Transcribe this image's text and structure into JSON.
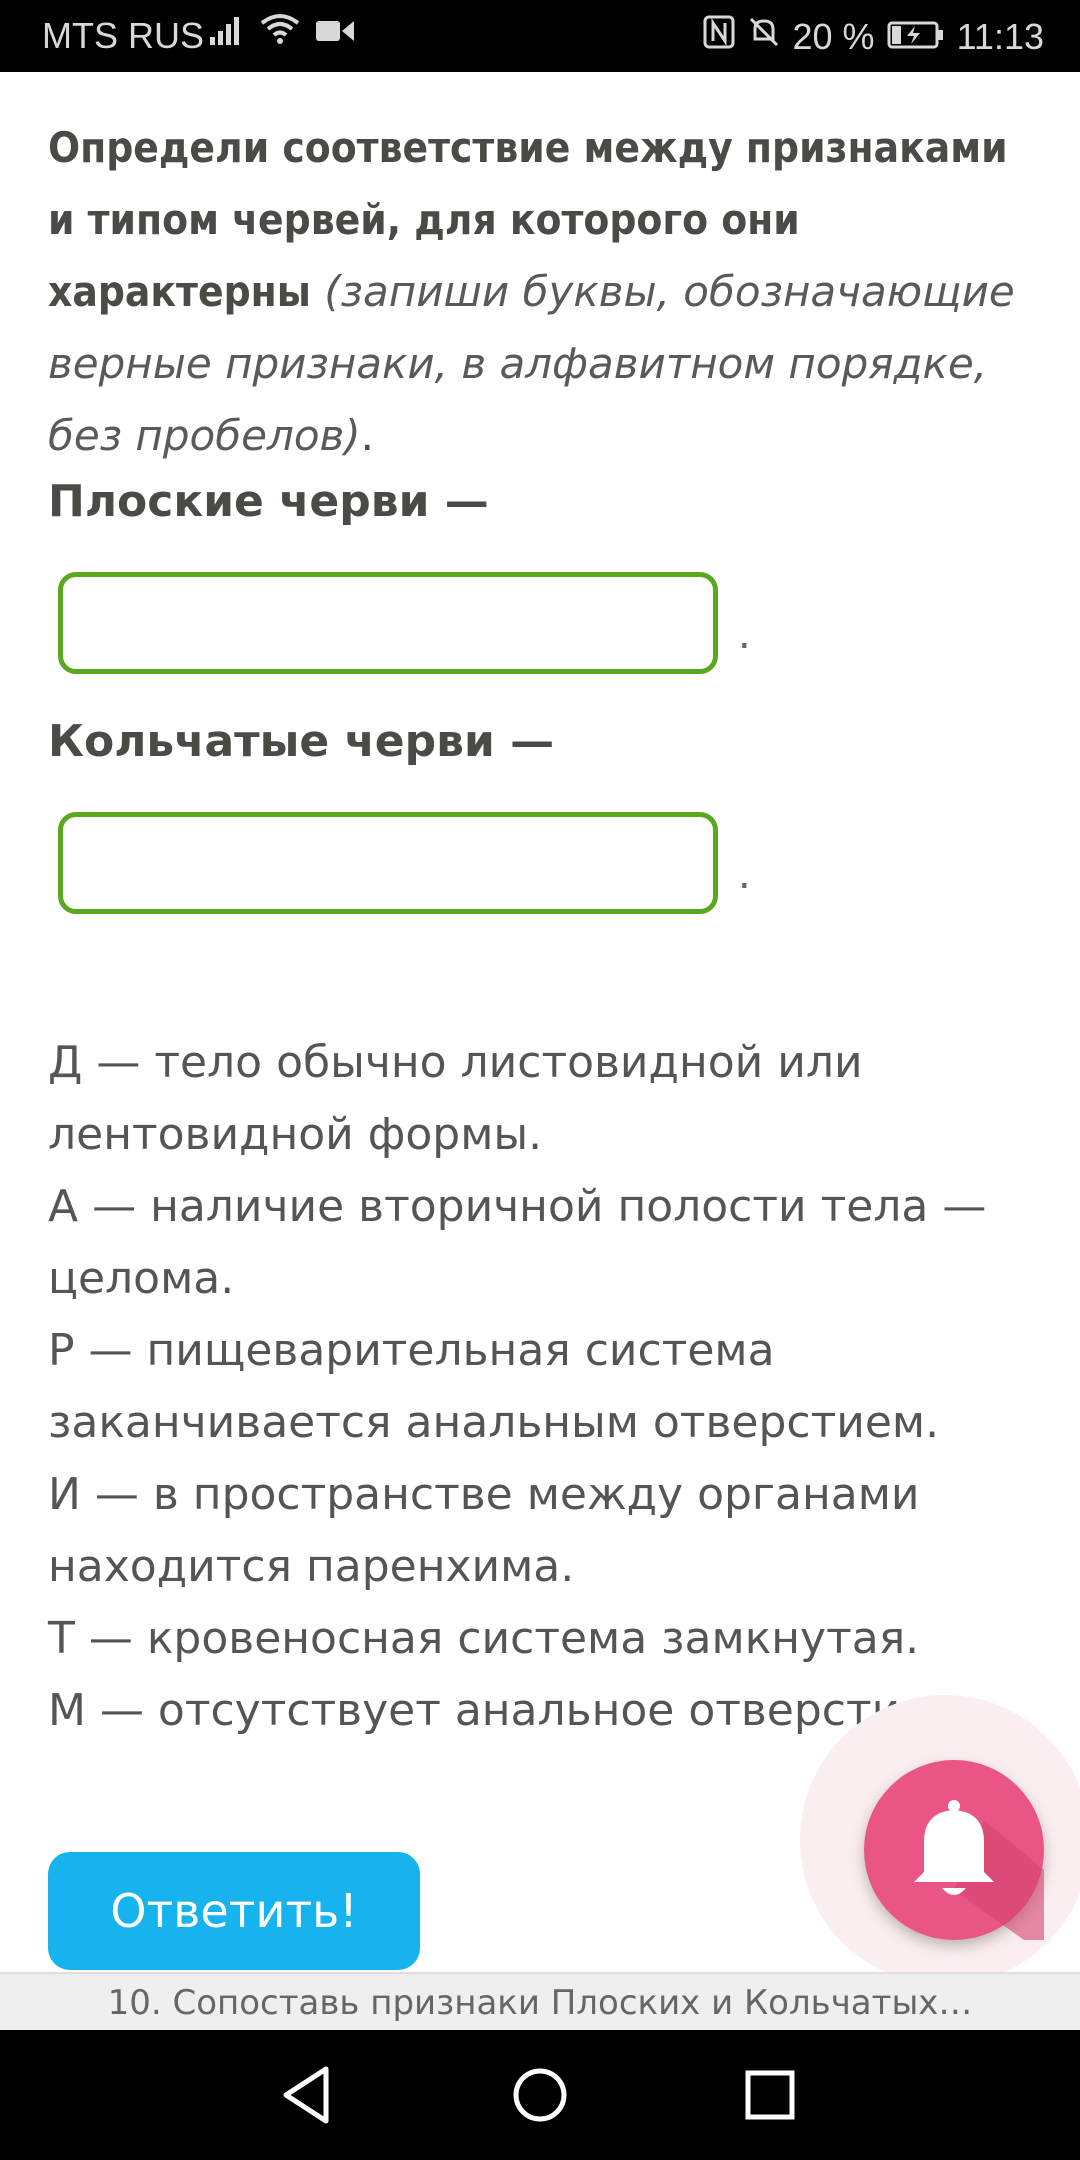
{
  "status_bar": {
    "carrier": "MTS RUS",
    "battery_percent": "20 %",
    "time": "11:13",
    "icons": [
      "signal-icon",
      "wifi-icon",
      "video-icon",
      "nfc-icon",
      "mute-icon",
      "battery-charging-icon"
    ]
  },
  "question": {
    "bold_text": "Определи соответствие между признаками и типом червей, для которого они характерны",
    "hint_text": "(запиши буквы, обозначающие верные признаки, в алфавитном порядке, без пробелов)",
    "end": "."
  },
  "answers": [
    {
      "label": "Плоские черви —",
      "value": "",
      "suffix": "."
    },
    {
      "label": "Кольчатые черви —",
      "value": "",
      "suffix": "."
    }
  ],
  "options": [
    "Д — тело обычно листовидной или лентовидной формы.",
    "А — наличие вторичной полости тела — целома.",
    "Р — пищеварительная система заканчивается анальным отверстием.",
    "И — в пространстве между органами находится паренхима.",
    "Т — кровеносная система замкнутая.",
    "М — отсутствует анальное отверстие."
  ],
  "submit_label": "Ответить!",
  "bottom_title": "10. Сопоставь признаки Плоских и Кольчатых…",
  "colors": {
    "input_border": "#5aa820",
    "submit_bg": "#16b3ef",
    "fab_bg": "#e95683"
  },
  "fab_icon": "bell-icon",
  "nav_icons": [
    "back-icon",
    "home-icon",
    "recents-icon"
  ]
}
